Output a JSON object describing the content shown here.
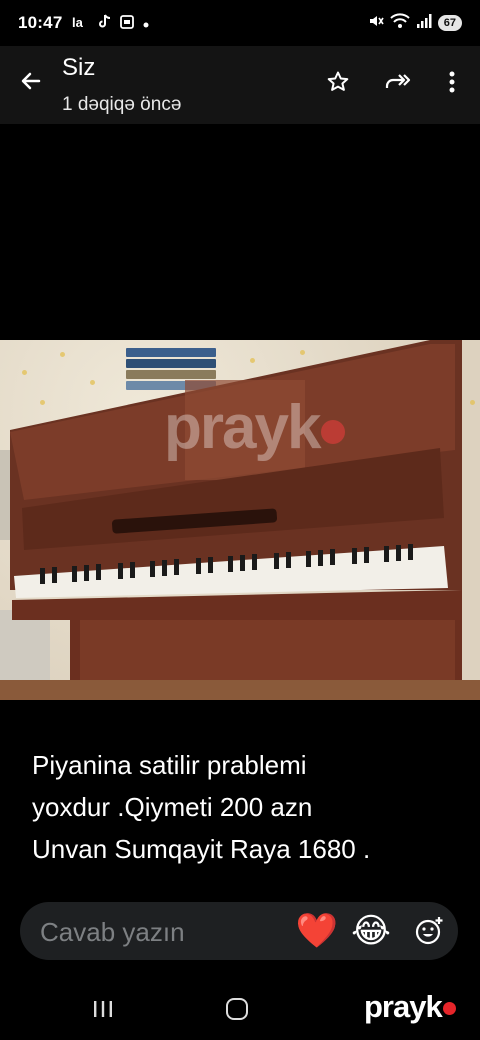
{
  "status_bar": {
    "time": "10:47",
    "left_icons": [
      "carrier-la-icon",
      "tiktok-icon",
      "screenshot-icon",
      "notification-dot-icon"
    ],
    "right_icons": [
      "mute-icon",
      "wifi-icon",
      "signal-icon"
    ],
    "battery": "67"
  },
  "header": {
    "title": "Siz",
    "subtitle": "1 dəqiqə öncə",
    "actions": [
      "star-icon",
      "forward-icon",
      "more-vert-icon"
    ]
  },
  "photo": {
    "description_icon": "piano-photo",
    "watermark": "prayk"
  },
  "caption": {
    "lines": [
      "Piyanina satilir prablemi",
      "yoxdur .Qiymeti 200 azn",
      "Unvan Sumqayit Raya 1680 ."
    ]
  },
  "reply": {
    "placeholder": "Cavab yazın",
    "quick_reactions": [
      "❤️",
      "😂"
    ],
    "emoji_add_icon": "emoji-add-icon"
  },
  "nav": {
    "logo": "prayk"
  },
  "colors": {
    "header_bg": "#141414",
    "reply_bg": "#1e2022",
    "logo_dot": "#e5252a"
  }
}
